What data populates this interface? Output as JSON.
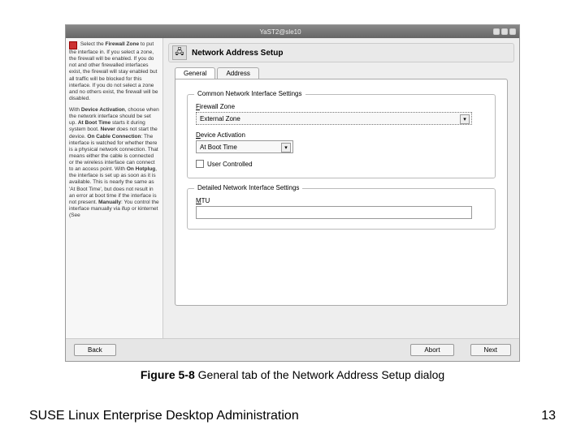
{
  "window": {
    "title": "YaST2@sle10"
  },
  "sidebar": {
    "icon": "firewall-icon",
    "para1_a": "Select the ",
    "para1_b": "Firewall Zone",
    "para1_c": " to put the interface in. If you select a zone, the firewall will be enabled. If you do not and other firewalled interfaces exist, the firewall will stay enabled but all traffic will be blocked for this interface. If you do not select a zone and no others exist, the firewall will be disabled.",
    "para2_a": "With ",
    "para2_b": "Device Activation",
    "para2_c": ", choose when the network interface should be set up. ",
    "para2_d": "At Boot Time",
    "para2_e": " starts it during system boot. ",
    "para2_f": "Never",
    "para2_g": " does not start the device. ",
    "para2_h": "On Cable Connection",
    "para2_i": ": The interface is watched for whether there is a physical network connection. That means either the cable is connected or the wireless interface can connect to an access point. With ",
    "para2_j": "On Hotplug",
    "para2_k": ", the interface is set up as soon as it is available. This is nearly the same as 'At Boot Time', but does not result in an error at boot time if the interface is not present. ",
    "para2_l": "Manually",
    "para2_m": ": You control the interface manually via ifup or kinternet (See"
  },
  "panel": {
    "icon": "network-icon",
    "title": "Network Address Setup"
  },
  "tabs": {
    "general": "General",
    "address": "Address"
  },
  "common_group": {
    "title": "Common Network Interface Settings",
    "fw_label_u": "F",
    "fw_label_rest": "irewall Zone",
    "fw_value": "External Zone",
    "da_label_u": "D",
    "da_label_rest": "evice Activation",
    "da_value": "At Boot Time",
    "uc_label_u": "U",
    "uc_label_rest": "ser Controlled"
  },
  "detailed_group": {
    "title": "Detailed Network Interface Settings",
    "mtu_label_u": "M",
    "mtu_label_rest": "TU",
    "mtu_value": ""
  },
  "footer": {
    "back": "Back",
    "abort": "Abort",
    "next": "Next"
  },
  "caption_b": "Figure 5-8",
  "caption_rest": " General tab of the Network Address Setup dialog",
  "book_title": "SUSE Linux Enterprise Desktop Administration",
  "page_num": "13"
}
